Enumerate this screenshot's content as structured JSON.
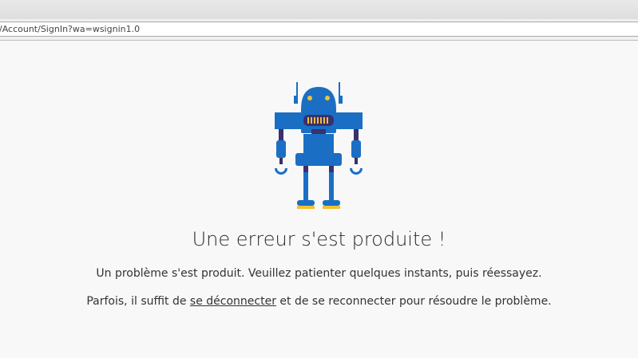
{
  "browser": {
    "url": "/Account/SignIn?wa=wsignin1.0"
  },
  "error": {
    "title": "Une erreur s'est produite !",
    "message": "Un problème s'est produit. Veuillez patienter quelques instants, puis réessayez.",
    "tip_before": "Parfois, il suffit de ",
    "tip_link": "se déconnecter",
    "tip_after": " et de se reconnecter pour résoudre le problème."
  },
  "illustration": {
    "icon": "robot-icon",
    "colors": {
      "body": "#1a6fc4",
      "dark": "#3b2f6e",
      "accent": "#f2c12e"
    }
  }
}
